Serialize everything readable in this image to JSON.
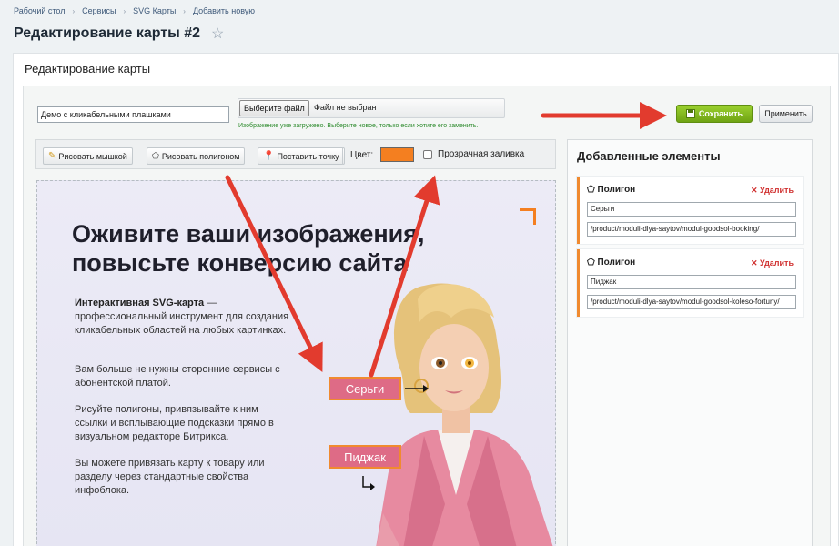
{
  "breadcrumb": [
    "Рабочий стол",
    "Сервисы",
    "SVG Карты",
    "Добавить новую"
  ],
  "page_title": "Редактирование карты #2",
  "panel_title": "Редактирование карты",
  "form": {
    "name_value": "Демо с кликабельными плашками",
    "file_button": "Выберите файл",
    "file_status": "Файл не выбран",
    "file_hint": "Изображение уже загружено. Выберите новое, только если хотите его заменить.",
    "save_label": "Сохранить",
    "apply_label": "Применить"
  },
  "toolbar": {
    "draw_mouse": "Рисовать мышкой",
    "draw_polygon": "Рисовать полигоном",
    "place_point": "Поставить точку",
    "color_label": "Цвет:",
    "color_value": "#f47f20",
    "transparent_label": "Прозрачная заливка",
    "transparent_checked": false
  },
  "canvas": {
    "headline": [
      "Оживите ваши изображения,",
      "повысьте конверсию сайта"
    ],
    "para1_bold": "Интерактивная SVG-карта",
    "para1_rest": " — профессиональный инструмент для создания кликабельных областей на любых картинках.",
    "para2": "Вам больше не нужны сторонние сервисы с абонентской платой.",
    "para3": "Рисуйте полигоны, привязывайте к ним ссылки и всплывающие подсказки прямо в визуальном редакторе Битрикса.",
    "para4": "Вы можете привязать карту к товару или разделу через стандартные свойства инфоблока.",
    "tag1": "Серьги",
    "tag2": "Пиджак"
  },
  "sidebar": {
    "title": "Добавленные элементы",
    "items": [
      {
        "type": "Полигон",
        "delete": "Удалить",
        "name": "Серьги",
        "link": "/product/moduli-dlya-saytov/modul-goodsol-booking/"
      },
      {
        "type": "Полигон",
        "delete": "Удалить",
        "name": "Пиджак",
        "link": "/product/moduli-dlya-saytov/modul-goodsol-koleso-fortuny/"
      }
    ]
  },
  "colors": {
    "accent": "#f47f20",
    "save_green": "#7cb518",
    "arrow_red": "#e23b2e",
    "tag_pink": "#de6b86"
  }
}
